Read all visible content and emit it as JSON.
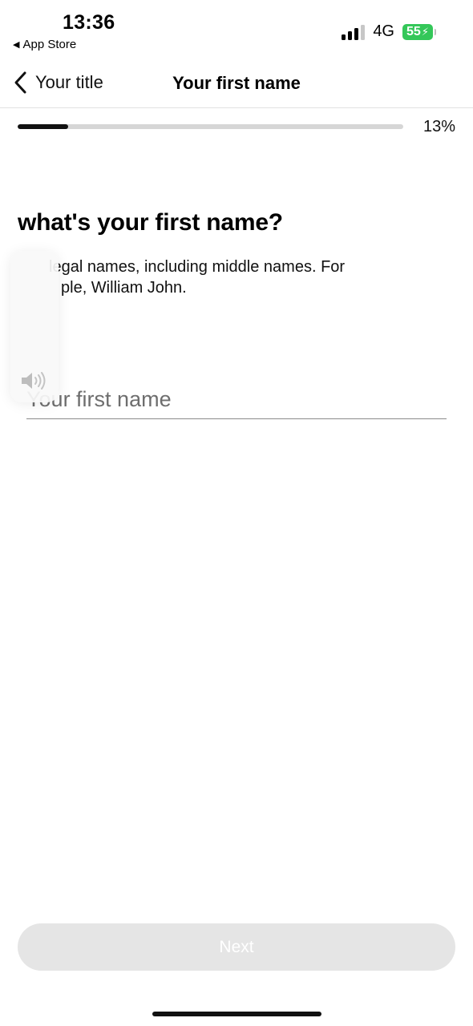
{
  "status_bar": {
    "time": "13:36",
    "back_app": "App Store",
    "network": "4G",
    "battery": "55",
    "battery_color": "#34c759"
  },
  "nav": {
    "back_label": "Your title",
    "title": "Your first name"
  },
  "progress": {
    "label": "13%",
    "value": 0.13
  },
  "content": {
    "heading": "what's your first name?",
    "helper_line1": "legal names, including middle names. For",
    "helper_line2": "ple, William John."
  },
  "first_name_field": {
    "placeholder": "Your first name",
    "value": ""
  },
  "next_button": {
    "label": "Next",
    "disabled_bg": "#e5e5e5"
  }
}
